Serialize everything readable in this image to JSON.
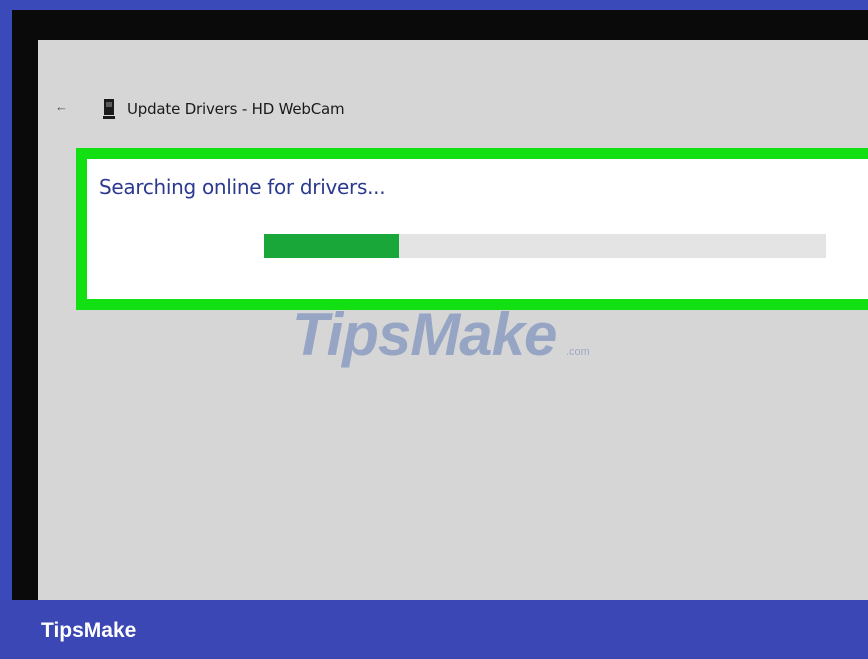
{
  "window": {
    "title": "Update Drivers - HD WebCam",
    "back_icon": "back-arrow-icon",
    "device_icon": "webcam-device-icon"
  },
  "status": {
    "message": "Searching online for drivers...",
    "progress": 0.24
  },
  "watermark": {
    "text": "TipsMake",
    "suffix": ".com"
  },
  "footer": {
    "brand": "TipsMake"
  },
  "colors": {
    "highlight": "#12e012",
    "progress_fill": "#1aa73a",
    "status_text": "#2b3a8f",
    "footer_bg": "#3b47b5"
  }
}
